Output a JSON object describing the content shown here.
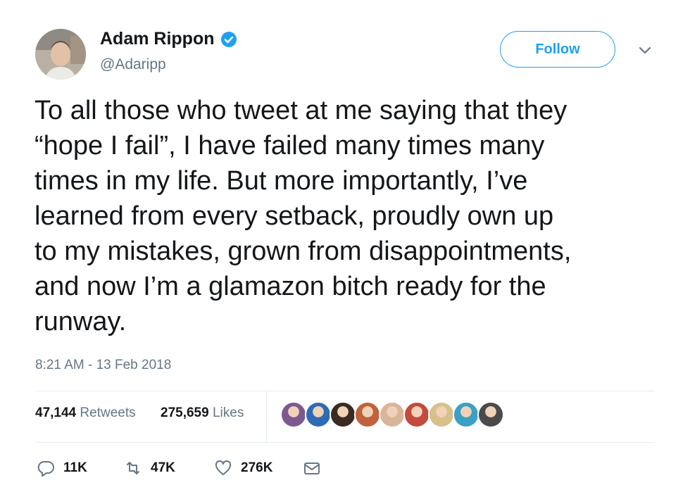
{
  "user": {
    "name": "Adam Rippon",
    "handle": "@Adaripp",
    "verified": true
  },
  "follow_label": "Follow",
  "tweet": {
    "text": "To all those who tweet at me saying that they\n“hope I fail”, I have failed many times many\ntimes in my life. But more importantly, I’ve\nlearned from every setback, proudly own up\nto my mistakes, grown from disappointments,\nand now I’m a glamazon bitch ready for the\nrunway.",
    "timestamp": "8:21 AM - 13 Feb 2018"
  },
  "stats": {
    "retweets_count": "47,144",
    "retweets_label": "Retweets",
    "likes_count": "275,659",
    "likes_label": "Likes"
  },
  "likers": [
    {
      "color": "#7c5a8f"
    },
    {
      "color": "#2d6cb5"
    },
    {
      "color": "#3a2a22"
    },
    {
      "color": "#c1623a"
    },
    {
      "color": "#d9b59a"
    },
    {
      "color": "#c44a3d"
    },
    {
      "color": "#d8c08a"
    },
    {
      "color": "#3aa0c4"
    },
    {
      "color": "#4a4a4a"
    }
  ],
  "actions": {
    "replies": "11K",
    "retweets": "47K",
    "likes": "276K"
  },
  "colors": {
    "accent": "#1da1f2",
    "secondary_text": "#657786",
    "primary_text": "#14171a",
    "divider": "#e6ecf0"
  }
}
